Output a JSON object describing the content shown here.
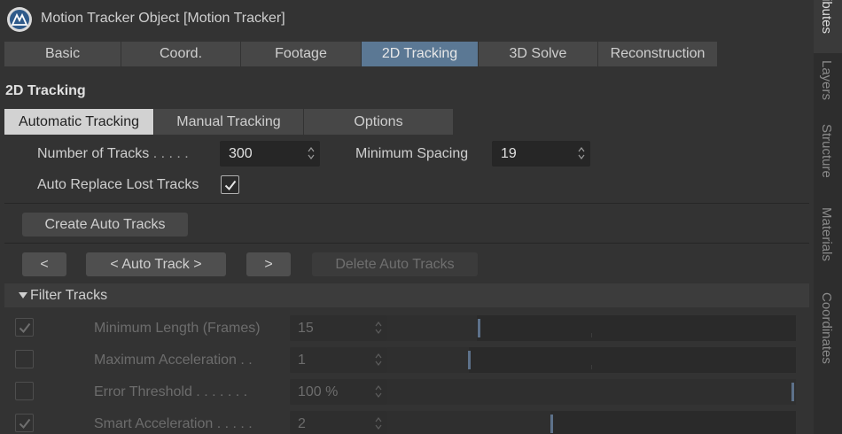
{
  "window": {
    "title": "Motion Tracker Object [Motion Tracker]",
    "logo_icon": "cinema4d-logo-icon"
  },
  "tabs": [
    {
      "label": "Basic",
      "active": false
    },
    {
      "label": "Coord.",
      "active": false
    },
    {
      "label": "Footage",
      "active": false
    },
    {
      "label": "2D Tracking",
      "active": true
    },
    {
      "label": "3D Solve",
      "active": false
    },
    {
      "label": "Reconstruction",
      "active": false
    }
  ],
  "section_title": "2D Tracking",
  "subtabs": [
    {
      "label": "Automatic Tracking",
      "active": true
    },
    {
      "label": "Manual Tracking",
      "active": false
    },
    {
      "label": "Options",
      "active": false
    }
  ],
  "params": {
    "number_of_tracks_label": "Number of Tracks",
    "number_of_tracks_dots": " . . . . .",
    "number_of_tracks_value": "300",
    "minimum_spacing_label": "Minimum Spacing",
    "minimum_spacing_value": "19",
    "auto_replace_label": "Auto Replace Lost Tracks",
    "auto_replace_checked": true
  },
  "buttons": {
    "create_auto_tracks": "Create Auto Tracks",
    "prev": "<",
    "auto_track": "< Auto Track >",
    "next": ">",
    "delete_auto_tracks": "Delete Auto Tracks"
  },
  "filter_tracks": {
    "header": "Filter Tracks",
    "expanded": true,
    "rows": [
      {
        "label": "Minimum Length (Frames)",
        "dots": "",
        "value": "15",
        "checked": true,
        "slider_fraction": 0.22
      },
      {
        "label": "Maximum Acceleration",
        "dots": " . .",
        "value": "1",
        "checked": false,
        "slider_fraction": 0.2
      },
      {
        "label": "Error Threshold",
        "dots": " . . . . . . .",
        "value": "100 %",
        "checked": false,
        "slider_fraction": 1.0
      },
      {
        "label": "Smart Acceleration",
        "dots": " . . . . .",
        "value": "2",
        "checked": true,
        "slider_fraction": 0.4
      }
    ]
  },
  "side_panel": {
    "tabs": [
      "Attributes",
      "Layers",
      "Structure",
      "Materials",
      "Coordinates"
    ],
    "visible_text": [
      "ibutes",
      "Layers",
      "Structure",
      "Materials",
      "Coordinates"
    ],
    "active": "Attributes"
  },
  "colors": {
    "accent_tab": "#5b7894",
    "slider_handle": "#5d718a",
    "background": "#333333"
  }
}
